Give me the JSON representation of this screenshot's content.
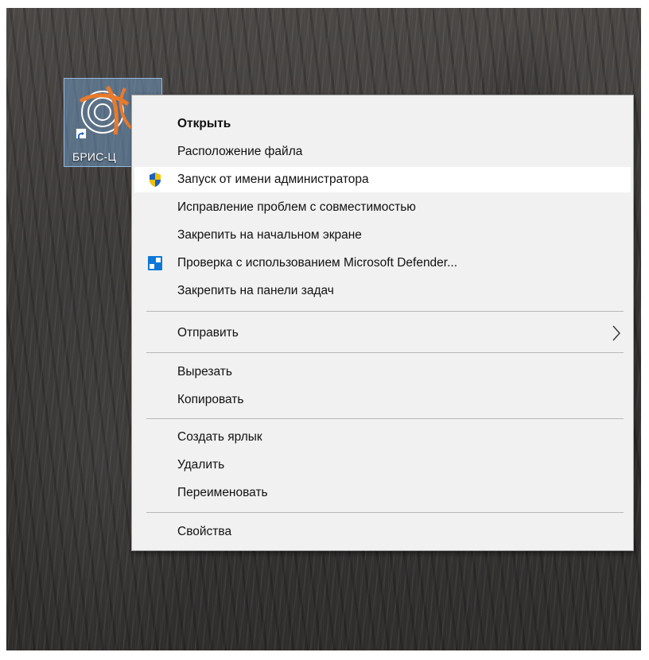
{
  "desktop": {
    "shortcut": {
      "label": "БРИС-Ц"
    }
  },
  "context_menu": {
    "groups": [
      [
        {
          "label": "Открыть",
          "bold": true,
          "icon": null
        },
        {
          "label": "Расположение файла",
          "icon": null
        },
        {
          "label": "Запуск от имени администратора",
          "icon": "uac-shield-icon",
          "highlighted": true
        },
        {
          "label": "Исправление проблем с совместимостью",
          "icon": null
        },
        {
          "label": "Закрепить на начальном экране",
          "icon": null
        },
        {
          "label": "Проверка с использованием Microsoft Defender...",
          "icon": "defender-icon"
        },
        {
          "label": "Закрепить на панели задач",
          "icon": null
        }
      ],
      [
        {
          "label": "Отправить",
          "submenu": true
        }
      ],
      [
        {
          "label": "Вырезать"
        },
        {
          "label": "Копировать"
        }
      ],
      [
        {
          "label": "Создать ярлык"
        },
        {
          "label": "Удалить"
        },
        {
          "label": "Переименовать"
        }
      ],
      [
        {
          "label": "Свойства"
        }
      ]
    ]
  },
  "colors": {
    "menu_background": "#f1f1f1",
    "highlight": "#ffffff",
    "separator": "#b8b8b8",
    "shield_blue": "#1f5fbf",
    "shield_yellow": "#f2c200",
    "defender_blue": "#0f78d7"
  }
}
